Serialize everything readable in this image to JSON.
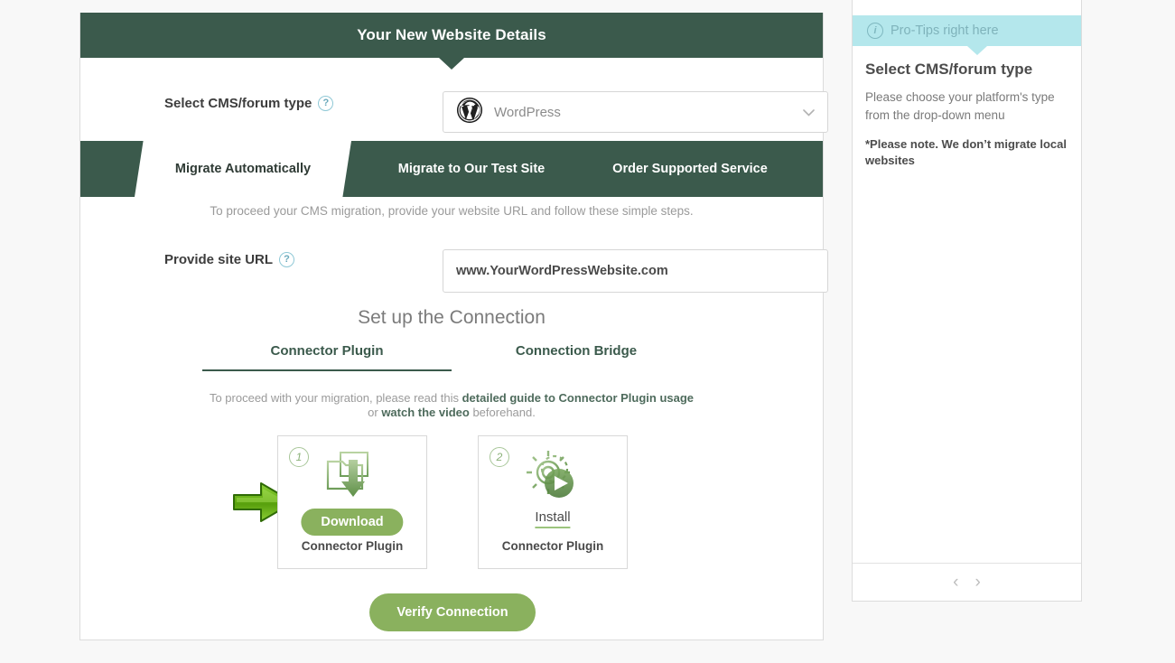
{
  "panel": {
    "header_title": "Your New Website Details",
    "cms_label": "Select CMS/forum type",
    "help_glyph": "?",
    "cms_selected": "WordPress",
    "cms_icon": "wordpress-logo-icon",
    "caret_glyph": "⌄",
    "tabs": [
      {
        "label": "Migrate Automatically",
        "active": true
      },
      {
        "label": "Migrate to Our Test Site",
        "active": false
      },
      {
        "label": "Order Supported Service",
        "active": false
      }
    ],
    "intro_text": "To proceed your CMS migration, provide your website URL and follow these simple steps.",
    "url_label": "Provide site URL",
    "url_value": "www.YourWordPressWebsite.com",
    "url_placeholder": "www.YourWordPressWebsite.com",
    "setup_title": "Set up the Connection",
    "subtabs": [
      {
        "label": "Connector Plugin",
        "active": true
      },
      {
        "label": "Connection Bridge",
        "active": false
      }
    ],
    "guide": {
      "prefix": "To proceed with your migration, please read this ",
      "link1": "detailed guide to Connector Plugin usage",
      "middle": " or ",
      "link2": "watch the video",
      "suffix": " beforehand."
    },
    "steps": [
      {
        "number": "1",
        "icon": "folder-download-icon",
        "action_label": "Download",
        "action_type": "button",
        "caption": "Connector Plugin"
      },
      {
        "number": "2",
        "icon": "gear-play-install-icon",
        "action_label": "Install",
        "action_type": "link",
        "caption": "Connector Plugin"
      }
    ],
    "step_separator_glyph": "›",
    "pointer_icon": "green-arrow-pointer-icon",
    "verify_label": "Verify Connection"
  },
  "sidebar": {
    "protips_label": "Pro-Tips right here",
    "info_glyph": "i",
    "tip_title": "Select CMS/forum type",
    "tip_text": "Please choose your platform's type from the drop-down menu",
    "tip_note": "*Please note. We don’t migrate local websites",
    "prev_glyph": "‹",
    "next_glyph": "›"
  },
  "colors": {
    "header_green": "#3b5a4c",
    "accent_green": "#8ab15e",
    "protips_cyan": "#b4e7ec",
    "page_bg": "#f8f8f8",
    "help_icon_blue": "#8fc8d6"
  }
}
